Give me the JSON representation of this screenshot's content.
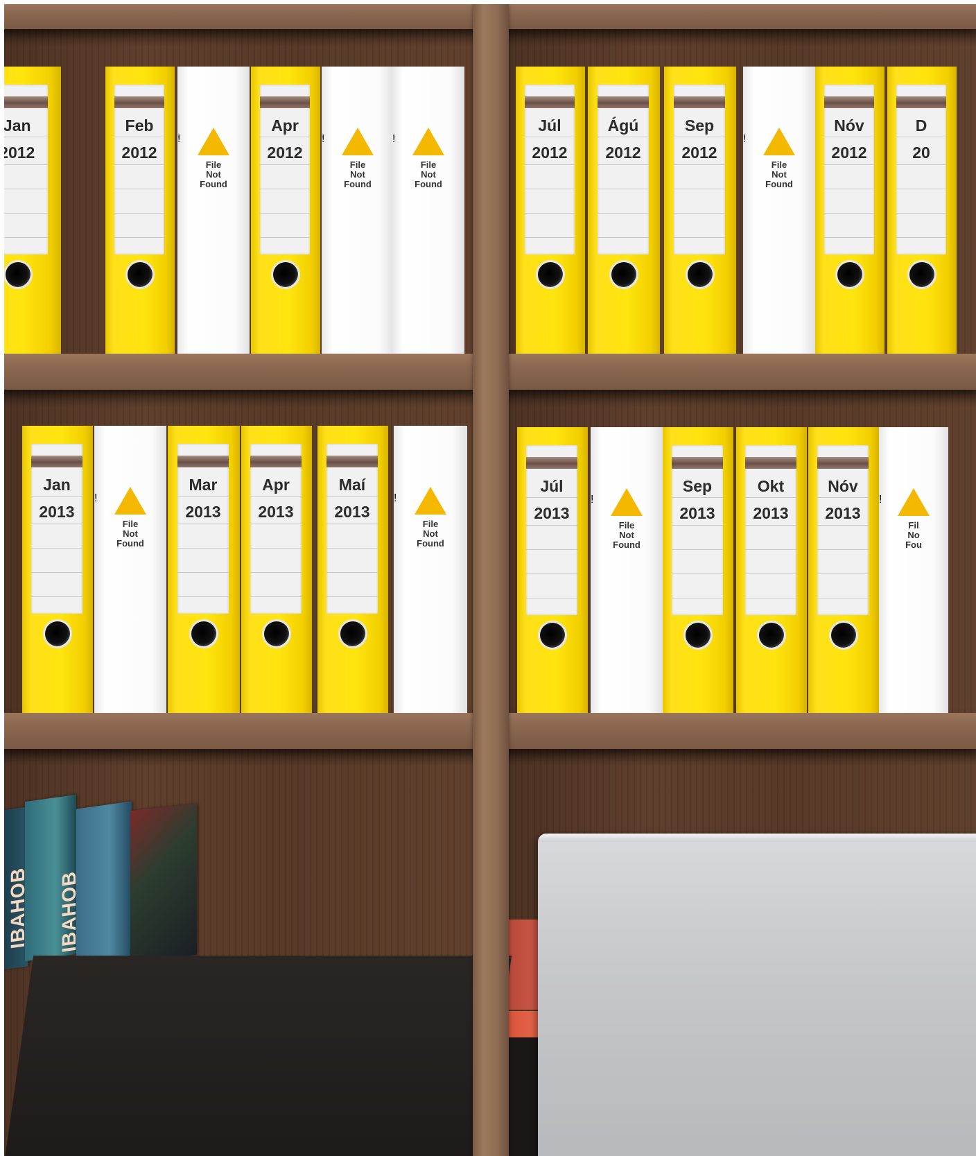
{
  "scene": {
    "top_left_shelf": [
      {
        "type": "binder",
        "month": "Jan",
        "year": "2012"
      },
      {
        "type": "binder",
        "month": "Feb",
        "year": "2012"
      },
      {
        "type": "missing",
        "line1": "File",
        "line2": "Not",
        "line3": "Found"
      },
      {
        "type": "binder",
        "month": "Apr",
        "year": "2012"
      },
      {
        "type": "missing",
        "line1": "File",
        "line2": "Not",
        "line3": "Found"
      },
      {
        "type": "missing",
        "line1": "File",
        "line2": "Not",
        "line3": "Found"
      }
    ],
    "top_right_shelf": [
      {
        "type": "binder",
        "month": "Júl",
        "year": "2012"
      },
      {
        "type": "binder",
        "month": "Ágú",
        "year": "2012"
      },
      {
        "type": "binder",
        "month": "Sep",
        "year": "2012"
      },
      {
        "type": "missing",
        "line1": "File",
        "line2": "Not",
        "line3": "Found"
      },
      {
        "type": "binder",
        "month": "Nóv",
        "year": "2012"
      },
      {
        "type": "binder",
        "month": "D",
        "year": "20"
      }
    ],
    "bottom_left_shelf": [
      {
        "type": "binder",
        "month": "Jan",
        "year": "2013"
      },
      {
        "type": "missing",
        "line1": "File",
        "line2": "Not",
        "line3": "Found"
      },
      {
        "type": "binder",
        "month": "Mar",
        "year": "2013"
      },
      {
        "type": "binder",
        "month": "Apr",
        "year": "2013"
      },
      {
        "type": "binder",
        "month": "Maí",
        "year": "2013"
      },
      {
        "type": "missing",
        "line1": "File",
        "line2": "Not",
        "line3": "Found"
      }
    ],
    "bottom_right_shelf": [
      {
        "type": "binder",
        "month": "Júl",
        "year": "2013"
      },
      {
        "type": "missing",
        "line1": "File",
        "line2": "Not",
        "line3": "Found"
      },
      {
        "type": "binder",
        "month": "Sep",
        "year": "2013"
      },
      {
        "type": "binder",
        "month": "Okt",
        "year": "2013"
      },
      {
        "type": "binder",
        "month": "Nóv",
        "year": "2013"
      },
      {
        "type": "missing",
        "line1": "Fil",
        "line2": "No",
        "line3": "Fou"
      }
    ],
    "book_spines": [
      "IBAHOB",
      "IBAHOB"
    ],
    "colors": {
      "binder_yellow": "#ffe40e",
      "warning_orange": "#f5b800",
      "wood": "#8b6850",
      "laptop_silver": "#c7c8cb"
    },
    "icon": "warning-triangle-icon"
  }
}
